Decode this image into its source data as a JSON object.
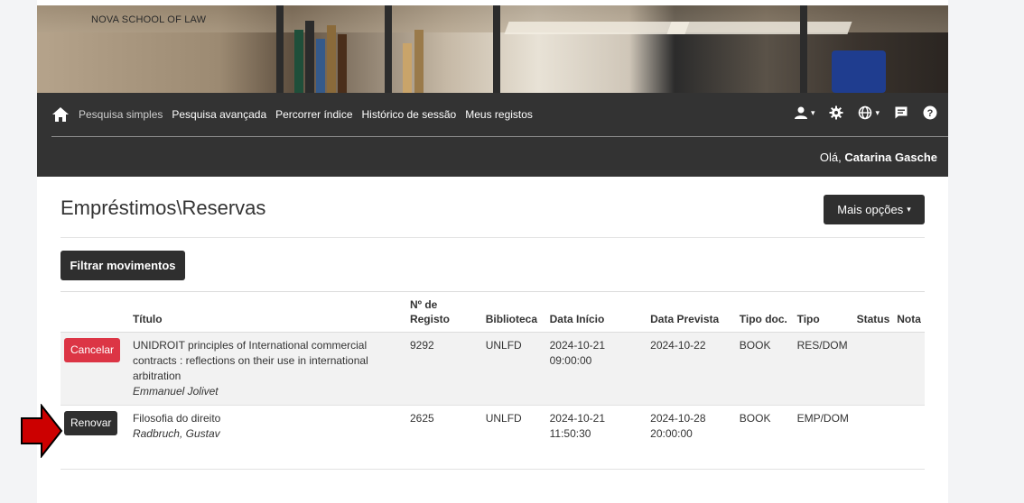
{
  "school_name": "NOVA SCHOOL OF LAW",
  "nav": {
    "links": [
      "Pesquisa simples",
      "Pesquisa avançada",
      "Percorrer índice",
      "Histórico de sessão",
      "Meus registos"
    ],
    "greeting_prefix": "Olá,",
    "user_name": "Catarina Gasche"
  },
  "page": {
    "title": "Empréstimos\\Reservas",
    "more_options": "Mais opções",
    "filter_button": "Filtrar movimentos"
  },
  "table": {
    "headers": {
      "titulo": "Título",
      "registo": "Nº de Registo",
      "biblioteca": "Biblioteca",
      "data_inicio": "Data Início",
      "data_prevista": "Data Prevista",
      "tipo_doc": "Tipo doc.",
      "tipo": "Tipo",
      "status": "Status",
      "nota": "Nota"
    },
    "rows": [
      {
        "action": "Cancelar",
        "title": "UNIDROIT principles of International commercial contracts : reflections on their use in international arbitration",
        "author": "Emmanuel Jolivet",
        "registo": "9292",
        "biblioteca": "UNLFD",
        "data_inicio_date": "2024-10-21",
        "data_inicio_time": "09:00:00",
        "data_prevista_date": "2024-10-22",
        "data_prevista_time": "",
        "tipo_doc": "BOOK",
        "tipo": "RES/DOM",
        "status": "",
        "nota": ""
      },
      {
        "action": "Renovar",
        "title": "Filosofia do direito",
        "author": "Radbruch, Gustav",
        "registo": "2625",
        "biblioteca": "UNLFD",
        "data_inicio_date": "2024-10-21",
        "data_inicio_time": "11:50:30",
        "data_prevista_date": "2024-10-28",
        "data_prevista_time": "20:00:00",
        "tipo_doc": "BOOK",
        "tipo": "EMP/DOM",
        "status": "",
        "nota": ""
      }
    ]
  },
  "colors": {
    "navbar": "#333333",
    "cancel": "#dc3545",
    "dark_button": "#2f2f2f",
    "arrow": "#cc0000"
  }
}
